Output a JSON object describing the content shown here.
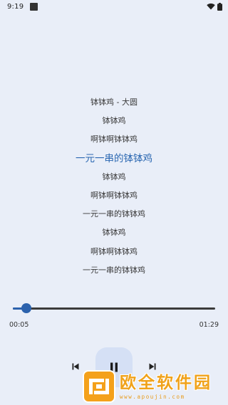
{
  "status_bar": {
    "time": "9:19"
  },
  "lyrics": {
    "current_index": 3,
    "lines": [
      "钵钵鸡 - 大圆",
      "钵钵鸡",
      "啊钵啊钵钵鸡",
      "一元一串的钵钵鸡",
      "钵钵鸡",
      "啊钵啊钵钵鸡",
      "一元一串的钵钵鸡",
      "钵钵鸡",
      "啊钵啊钵钵鸡",
      "一元一串的钵钵鸡"
    ]
  },
  "player": {
    "elapsed": "00:05",
    "total": "01:29",
    "progress_fraction": 0.067
  },
  "icons": {
    "wifi": "wifi-icon",
    "battery": "battery-icon",
    "previous": "skip-previous-icon",
    "pause": "pause-icon",
    "next": "skip-next-icon"
  },
  "colors": {
    "accent": "#2c62ad",
    "current_lyric": "#2a67b1",
    "background": "#e9eef8",
    "play_button_bg": "#d5e0f5",
    "watermark": "#f0a21a"
  },
  "watermark": {
    "title": "欧全软件园",
    "url": "www.apoujin.com"
  }
}
